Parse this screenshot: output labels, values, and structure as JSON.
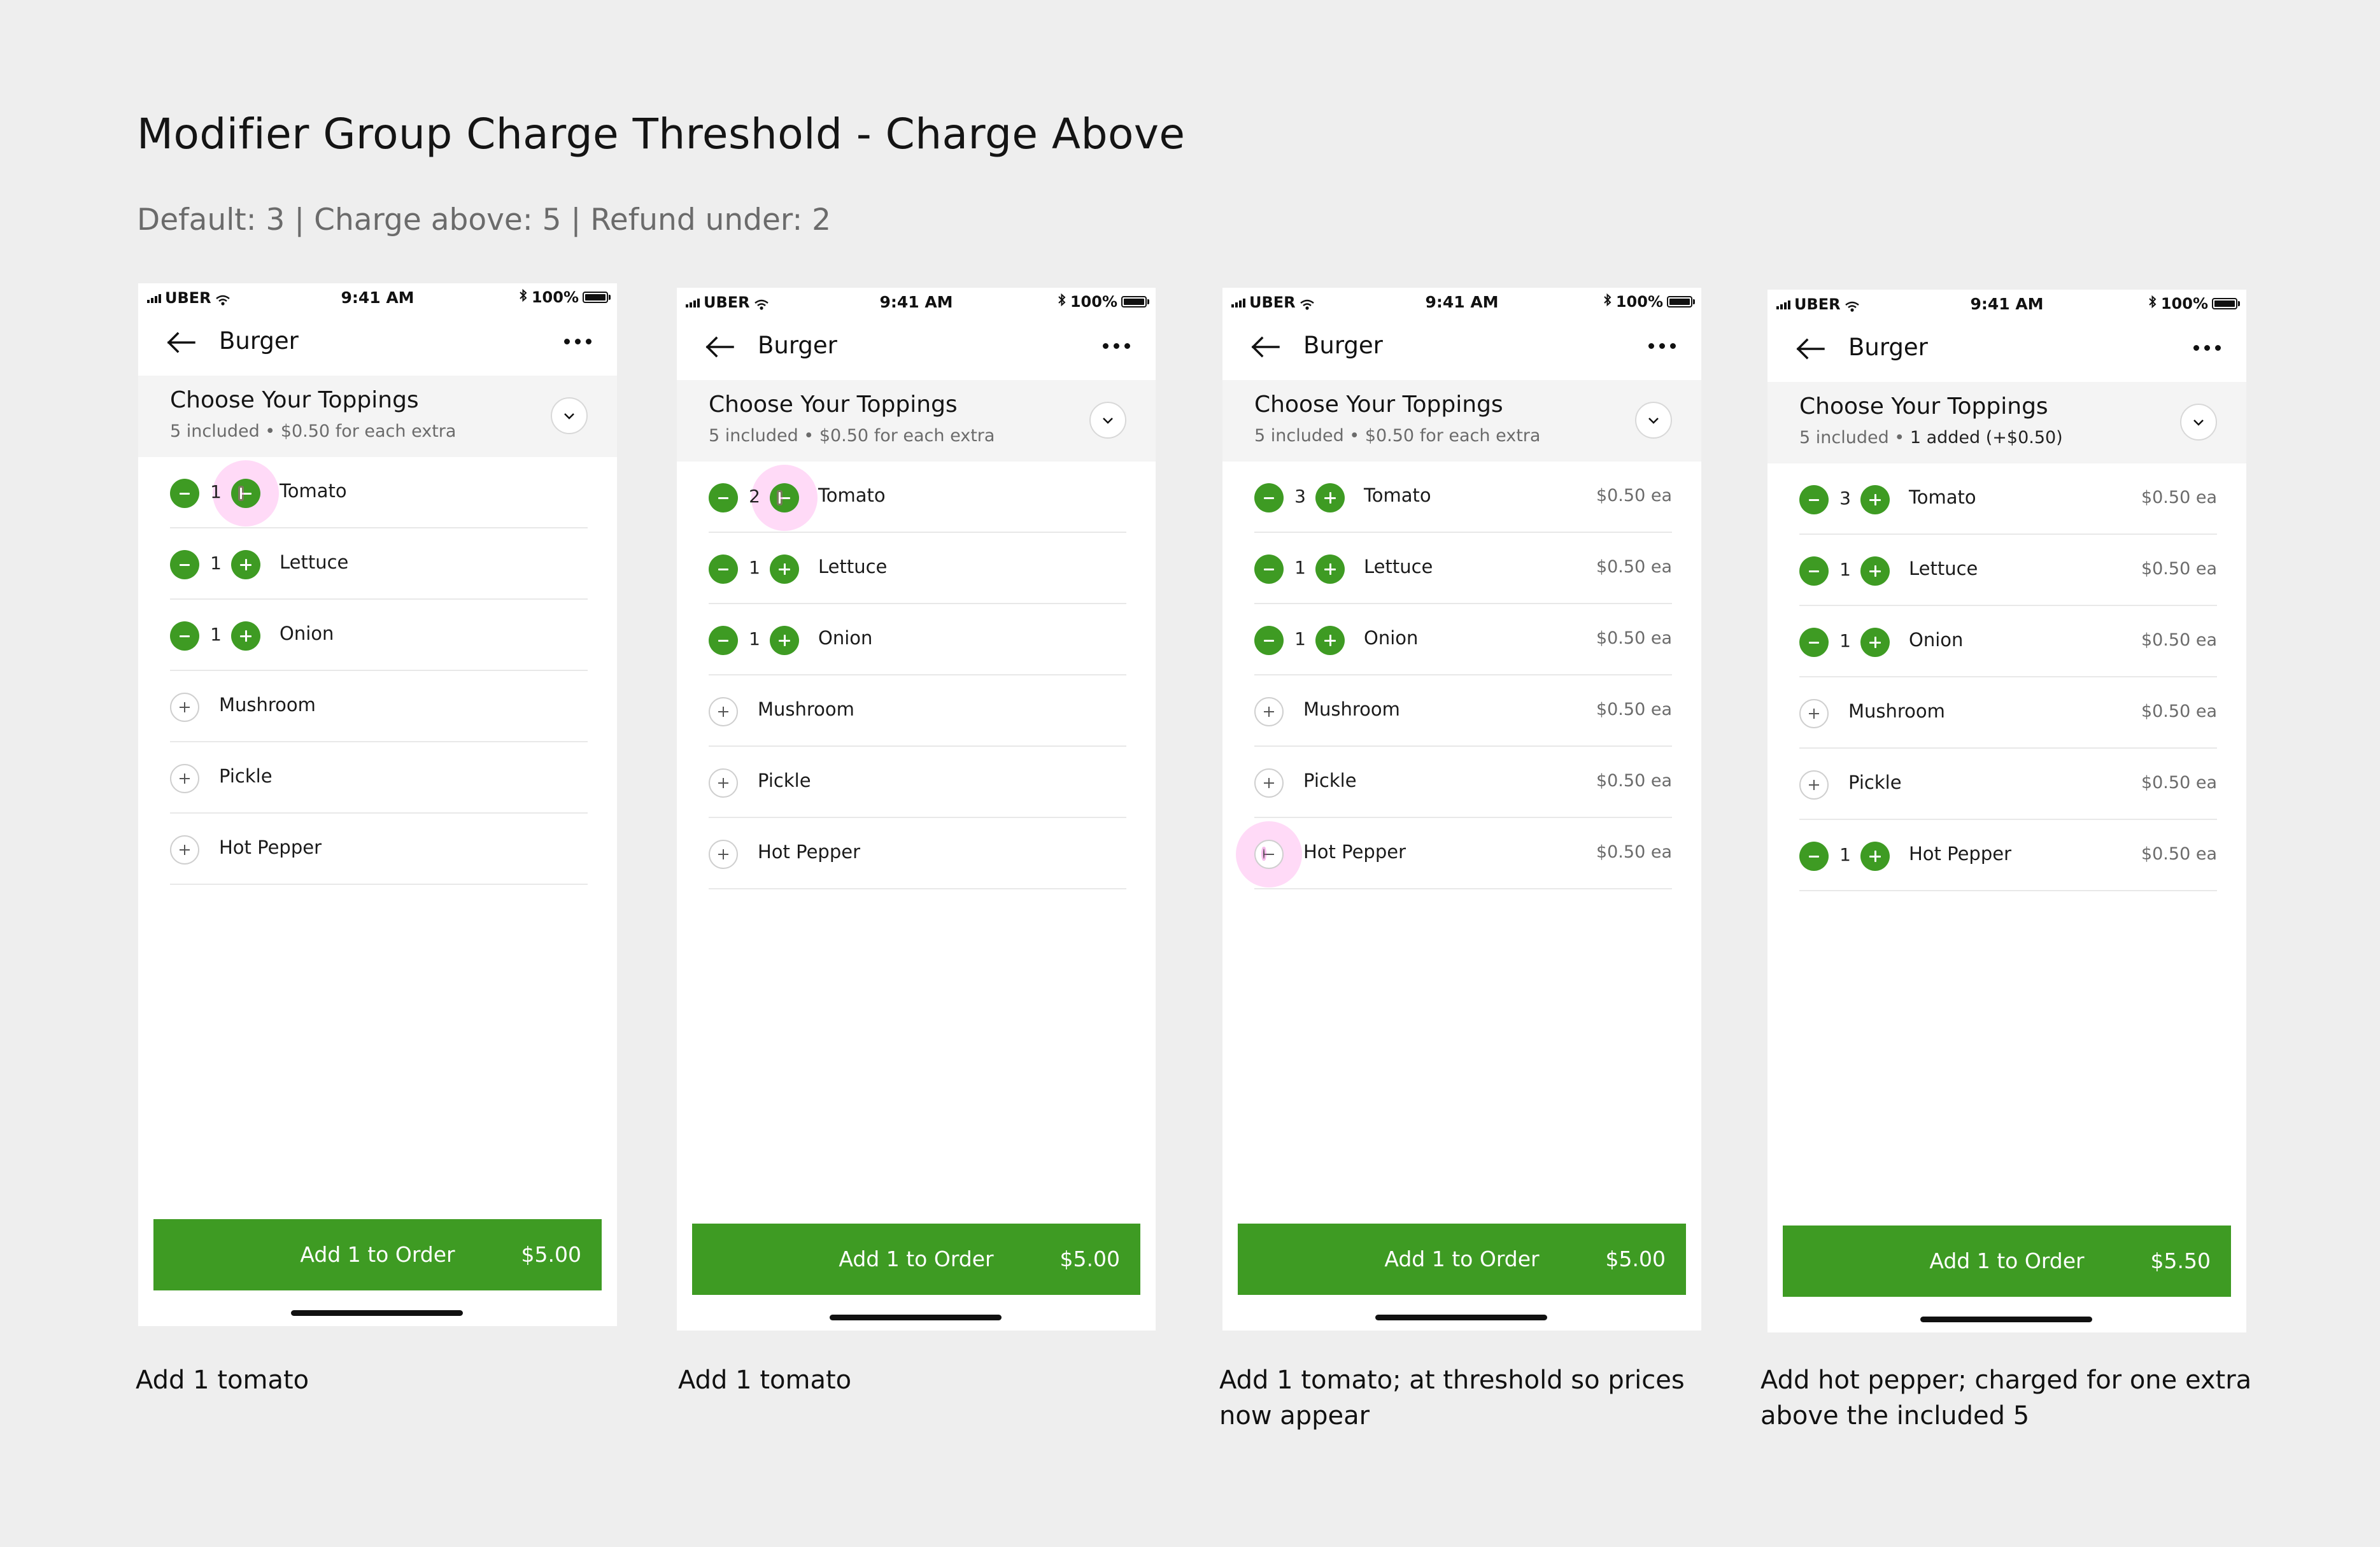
{
  "page": {
    "title": "Modifier Group Charge Threshold - Charge Above",
    "subtitle": "Default: 3  |  Charge above: 5  |  Refund under: 2"
  },
  "status_bar": {
    "carrier": "UBER",
    "time": "9:41 AM",
    "battery": "100%"
  },
  "screens": [
    {
      "nav_title": "Burger",
      "group": {
        "title": "Choose Your Toppings",
        "subtitle_lead": "5 included • ",
        "subtitle_bold": "",
        "subtitle_tail": "$0.50 for each extra"
      },
      "items": [
        {
          "name": "Tomato",
          "qty": "1",
          "price": ""
        },
        {
          "name": "Lettuce",
          "qty": "1",
          "price": ""
        },
        {
          "name": "Onion",
          "qty": "1",
          "price": ""
        },
        {
          "name": "Mushroom",
          "qty": "",
          "price": ""
        },
        {
          "name": "Pickle",
          "qty": "",
          "price": ""
        },
        {
          "name": "Hot Pepper",
          "qty": "",
          "price": ""
        }
      ],
      "order_label": "Add 1 to Order",
      "order_price": "$5.00",
      "caption": "Add 1 tomato"
    },
    {
      "nav_title": "Burger",
      "group": {
        "title": "Choose Your Toppings",
        "subtitle_lead": "5 included • ",
        "subtitle_bold": "",
        "subtitle_tail": "$0.50 for each extra"
      },
      "items": [
        {
          "name": "Tomato",
          "qty": "2",
          "price": ""
        },
        {
          "name": "Lettuce",
          "qty": "1",
          "price": ""
        },
        {
          "name": "Onion",
          "qty": "1",
          "price": ""
        },
        {
          "name": "Mushroom",
          "qty": "",
          "price": ""
        },
        {
          "name": "Pickle",
          "qty": "",
          "price": ""
        },
        {
          "name": "Hot Pepper",
          "qty": "",
          "price": ""
        }
      ],
      "order_label": "Add 1 to Order",
      "order_price": "$5.00",
      "caption": "Add 1 tomato"
    },
    {
      "nav_title": "Burger",
      "group": {
        "title": "Choose Your Toppings",
        "subtitle_lead": "5 included • ",
        "subtitle_bold": "",
        "subtitle_tail": "$0.50 for each extra"
      },
      "items": [
        {
          "name": "Tomato",
          "qty": "3",
          "price": "$0.50 ea"
        },
        {
          "name": "Lettuce",
          "qty": "1",
          "price": "$0.50 ea"
        },
        {
          "name": "Onion",
          "qty": "1",
          "price": "$0.50 ea"
        },
        {
          "name": "Mushroom",
          "qty": "",
          "price": "$0.50 ea"
        },
        {
          "name": "Pickle",
          "qty": "",
          "price": "$0.50 ea"
        },
        {
          "name": "Hot Pepper",
          "qty": "",
          "price": "$0.50 ea"
        }
      ],
      "order_label": "Add 1 to Order",
      "order_price": "$5.00",
      "caption": "Add 1 tomato; at threshold so prices now appear"
    },
    {
      "nav_title": "Burger",
      "group": {
        "title": "Choose Your Toppings",
        "subtitle_lead": "5 included • ",
        "subtitle_bold": "1 added (+$0.50)",
        "subtitle_tail": ""
      },
      "items": [
        {
          "name": "Tomato",
          "qty": "3",
          "price": "$0.50 ea"
        },
        {
          "name": "Lettuce",
          "qty": "1",
          "price": "$0.50 ea"
        },
        {
          "name": "Onion",
          "qty": "1",
          "price": "$0.50 ea"
        },
        {
          "name": "Mushroom",
          "qty": "",
          "price": "$0.50 ea"
        },
        {
          "name": "Pickle",
          "qty": "",
          "price": "$0.50 ea"
        },
        {
          "name": "Hot Pepper",
          "qty": "1",
          "price": "$0.50 ea"
        }
      ],
      "order_label": "Add 1 to Order",
      "order_price": "$5.50",
      "caption": "Add hot pepper; charged for one extra above the included 5"
    }
  ],
  "colors": {
    "accent_green": "#3e9b23",
    "tap_highlight": "#e93cc8",
    "background": "#eeeeee"
  },
  "icons": [
    "back-arrow-icon",
    "more-icon",
    "chevron-down-icon",
    "plus-icon",
    "minus-icon",
    "signal-icon",
    "wifi-icon",
    "bluetooth-icon",
    "battery-icon"
  ]
}
